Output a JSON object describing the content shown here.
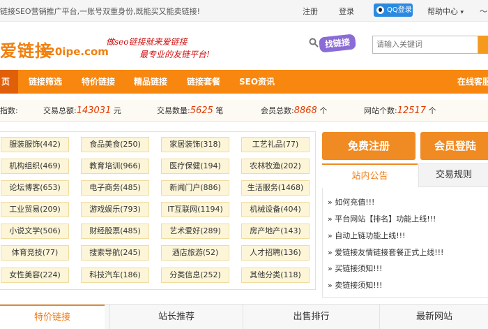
{
  "topbar": {
    "slogan": "链接SEO营销推广平台,一账号双重身份,既能买又能卖链接!",
    "register": "注册",
    "login": "登录",
    "qq_login": "QQ登录",
    "help_center": "帮助中心",
    "help_caret": "▾",
    "extra": "〜"
  },
  "header": {
    "logo_cn": "爱链接",
    "logo_en": "520ipe.com",
    "tagline_1": "做seo链接就来爱链接",
    "tagline_2": "最专业的友链平台!",
    "find_badge": "找链接",
    "search_placeholder": "请输入关键词"
  },
  "nav": {
    "items": [
      "页",
      "链接筛选",
      "特价链接",
      "精品链接",
      "链接套餐",
      "SEO资讯"
    ],
    "right": "在线客服"
  },
  "stats": {
    "label": "指数:",
    "items": [
      {
        "label": "交易总额:",
        "value": "143031",
        "unit": "元"
      },
      {
        "label": "交易数量:",
        "value": "5625",
        "unit": "笔"
      },
      {
        "label": "会员总数:",
        "value": "8868",
        "unit": "个"
      },
      {
        "label": "网站个数:",
        "value": "12517",
        "unit": "个"
      }
    ]
  },
  "categories": [
    "服装服饰(442)",
    "食品美食(250)",
    "家居装饰(318)",
    "工艺礼品(77)",
    "机构组织(469)",
    "教育培训(966)",
    "医疗保健(194)",
    "农林牧渔(202)",
    "论坛博客(653)",
    "电子商务(485)",
    "新闻门户(886)",
    "生活服务(1468)",
    "工业贸易(209)",
    "游戏娱乐(793)",
    "IT互联网(1194)",
    "机械设备(404)",
    "小说文学(506)",
    "财经股票(485)",
    "艺术爱好(289)",
    "房产地产(143)",
    "体育竞技(77)",
    "搜索导航(245)",
    "酒店旅游(52)",
    "人才招聘(136)",
    "女性美容(224)",
    "科技汽车(186)",
    "分类信息(252)",
    "其他分类(118)"
  ],
  "actions": {
    "register": "免费注册",
    "login": "会员登陆"
  },
  "notice": {
    "tab_active": "站内公告",
    "tab_other": "交易规则",
    "items": [
      "» 如何充值!!!",
      "» 平台网站【排名】功能上线!!!",
      "» 自动上链功能上线!!!",
      "» 爱链接友情链接套餐正式上线!!!",
      "» 买链接须知!!!",
      "» 卖链接须知!!!"
    ]
  },
  "bottom_tabs": [
    "特价链接",
    "站长推荐",
    "出售排行",
    "最新网站"
  ],
  "colors": {
    "brand_orange": "#f7870f",
    "number_red": "#e03a00",
    "qq_blue": "#2b8ae0",
    "badge_purple": "#8b6cd6"
  }
}
